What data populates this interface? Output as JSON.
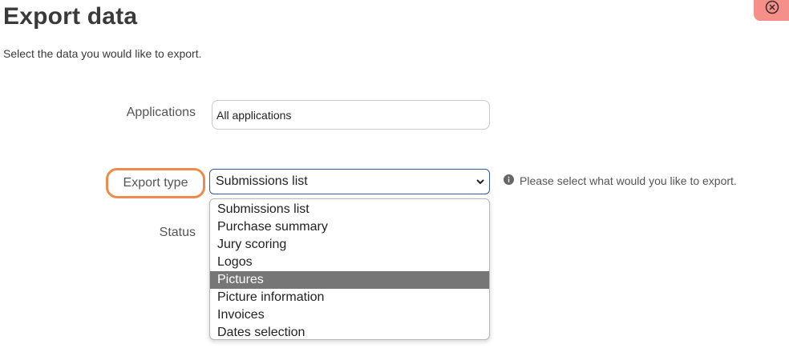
{
  "header": {
    "title": "Export data",
    "subtitle": "Select the data you would like to export."
  },
  "close_button": {
    "icon": "close-circle-icon",
    "color": "#f58f8a"
  },
  "form": {
    "applications": {
      "label": "Applications",
      "value": "All applications"
    },
    "export_type": {
      "label": "Export type",
      "selected": "Submissions list",
      "hint": "Please select what would you like to export.",
      "highlight_color": "#f08a4b",
      "options": [
        "Submissions list",
        "Purchase summary",
        "Jury scoring",
        "Logos",
        "Pictures",
        "Picture information",
        "Invoices",
        "Dates selection"
      ],
      "hovered_option": "Pictures"
    },
    "status": {
      "label": "Status"
    }
  }
}
